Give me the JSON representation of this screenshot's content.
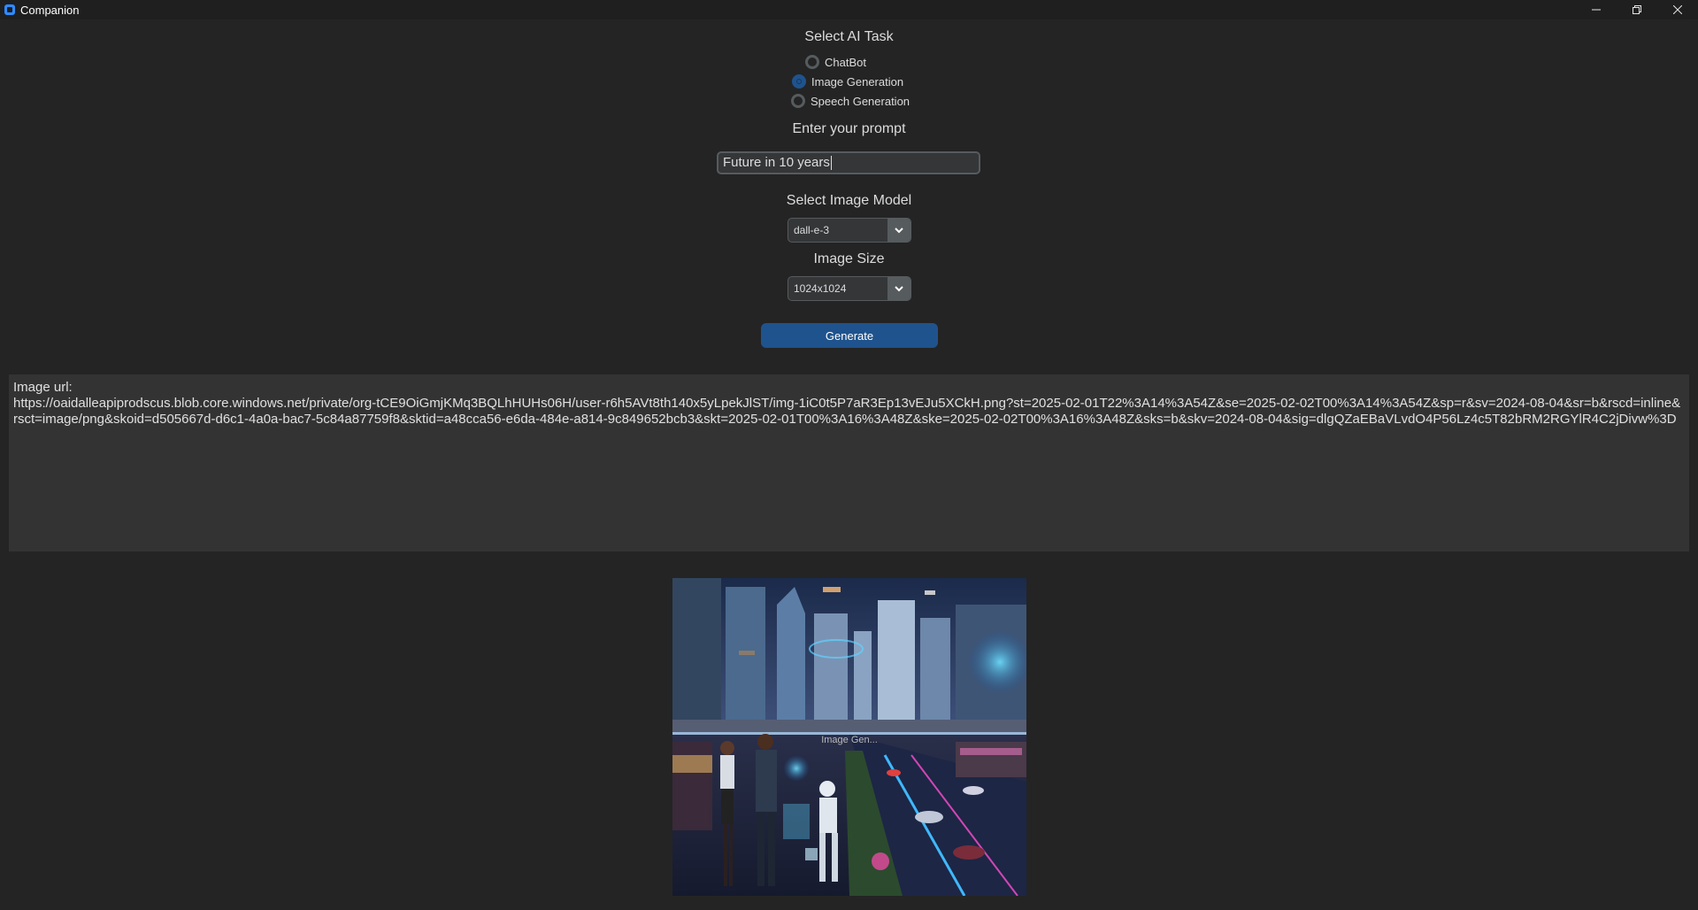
{
  "window": {
    "title": "Companion",
    "controls": [
      "minimize",
      "restore",
      "close"
    ]
  },
  "task": {
    "heading": "Select AI Task",
    "options": [
      {
        "label": "ChatBot",
        "selected": false
      },
      {
        "label": "Image Generation",
        "selected": true
      },
      {
        "label": "Speech Generation",
        "selected": false
      }
    ]
  },
  "prompt": {
    "heading": "Enter your prompt",
    "value": "Future in 10 years"
  },
  "model": {
    "heading": "Select Image Model",
    "value": "dall-e-3"
  },
  "size": {
    "heading": "Image Size",
    "value": "1024x1024"
  },
  "generate": {
    "label": "Generate"
  },
  "output": {
    "label": "Image url:",
    "url": "https://oaidalleapiprodscus.blob.core.windows.net/private/org-tCE9OiGmjKMq3BQLhHUHs06H/user-r6h5AVt8th140x5yLpekJlST/img-1iC0t5P7aR3Ep13vEJu5XCkH.png?st=2025-02-01T22%3A14%3A54Z&se=2025-02-02T00%3A14%3A54Z&sp=r&sv=2024-08-04&sr=b&rscd=inline&rsct=image/png&skoid=d505667d-d6c1-4a0a-bac7-5c84a87759f8&sktid=a48cca56-e6da-484e-a814-9c849652bcb3&skt=2025-02-01T00%3A16%3A48Z&ske=2025-02-02T00%3A16%3A48Z&sks=b&skv=2024-08-04&sig=dlgQZaEBaVLvdO4P56Lz4c5T82bRM2RGYlR4C2jDivw%3D"
  },
  "image": {
    "overlay_text": "Image Gen..."
  },
  "colors": {
    "background": "#242424",
    "accent": "#1f538d",
    "input_bg": "#343638",
    "border": "#565b5e",
    "text_box_bg": "#333333"
  }
}
